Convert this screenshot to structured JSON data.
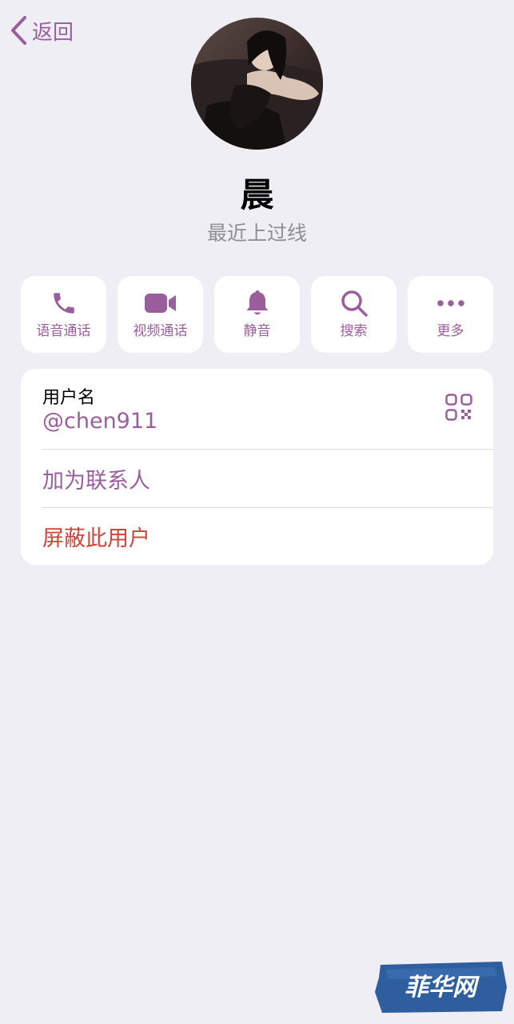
{
  "nav": {
    "back_label": "返回"
  },
  "profile": {
    "name": "晨",
    "status": "最近上过线"
  },
  "actions": [
    {
      "label": "语音通话",
      "icon": "phone-icon"
    },
    {
      "label": "视频通话",
      "icon": "video-camera-icon"
    },
    {
      "label": "静音",
      "icon": "bell-icon"
    },
    {
      "label": "搜索",
      "icon": "search-icon"
    },
    {
      "label": "更多",
      "icon": "more-icon"
    }
  ],
  "info": {
    "username_label": "用户名",
    "username_value": "@chen911",
    "add_contact": "加为联系人",
    "block_user": "屏蔽此用户"
  },
  "watermark": {
    "text": "菲华网"
  },
  "colors": {
    "accent": "#9B5E9D",
    "danger": "#D2433A",
    "background": "#EFEEF4",
    "secondary_text": "#8E8E93"
  }
}
